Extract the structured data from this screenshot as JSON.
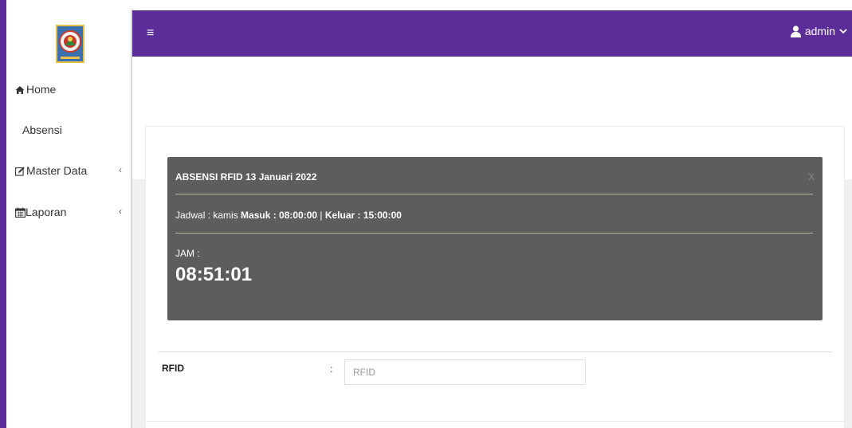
{
  "sidebar": {
    "logo_icon": "institution-emblem-icon",
    "items": [
      {
        "label": "Home",
        "icon": "home-icon"
      },
      {
        "label": "Absensi",
        "icon": ""
      },
      {
        "label": "Master Data",
        "icon": "edit-icon",
        "chevron": "‹"
      },
      {
        "label": "Laporan",
        "icon": "calendar-icon",
        "chevron": "‹"
      }
    ]
  },
  "topbar": {
    "menu_icon": "≡",
    "user_icon": "user-icon",
    "user_name": "admin",
    "user_chevron": "⌄"
  },
  "panel": {
    "title": "ABSENSI RFID 13 Januari 2022",
    "close": "X",
    "schedule_prefix": "Jadwal : kamis ",
    "masuk_label": "Masuk : 08:00:00",
    "separator": " | ",
    "keluar_label": "Keluar : 15:00:00",
    "jam_label": "JAM :",
    "clock": "08:51:01"
  },
  "form": {
    "rfid_label": "RFID",
    "colon": ":",
    "rfid_placeholder": "RFID",
    "rfid_value": ""
  },
  "colors": {
    "brand": "#5b2d99",
    "panel_bg": "#5d5d5d",
    "panel_line": "#b7ba9a"
  }
}
